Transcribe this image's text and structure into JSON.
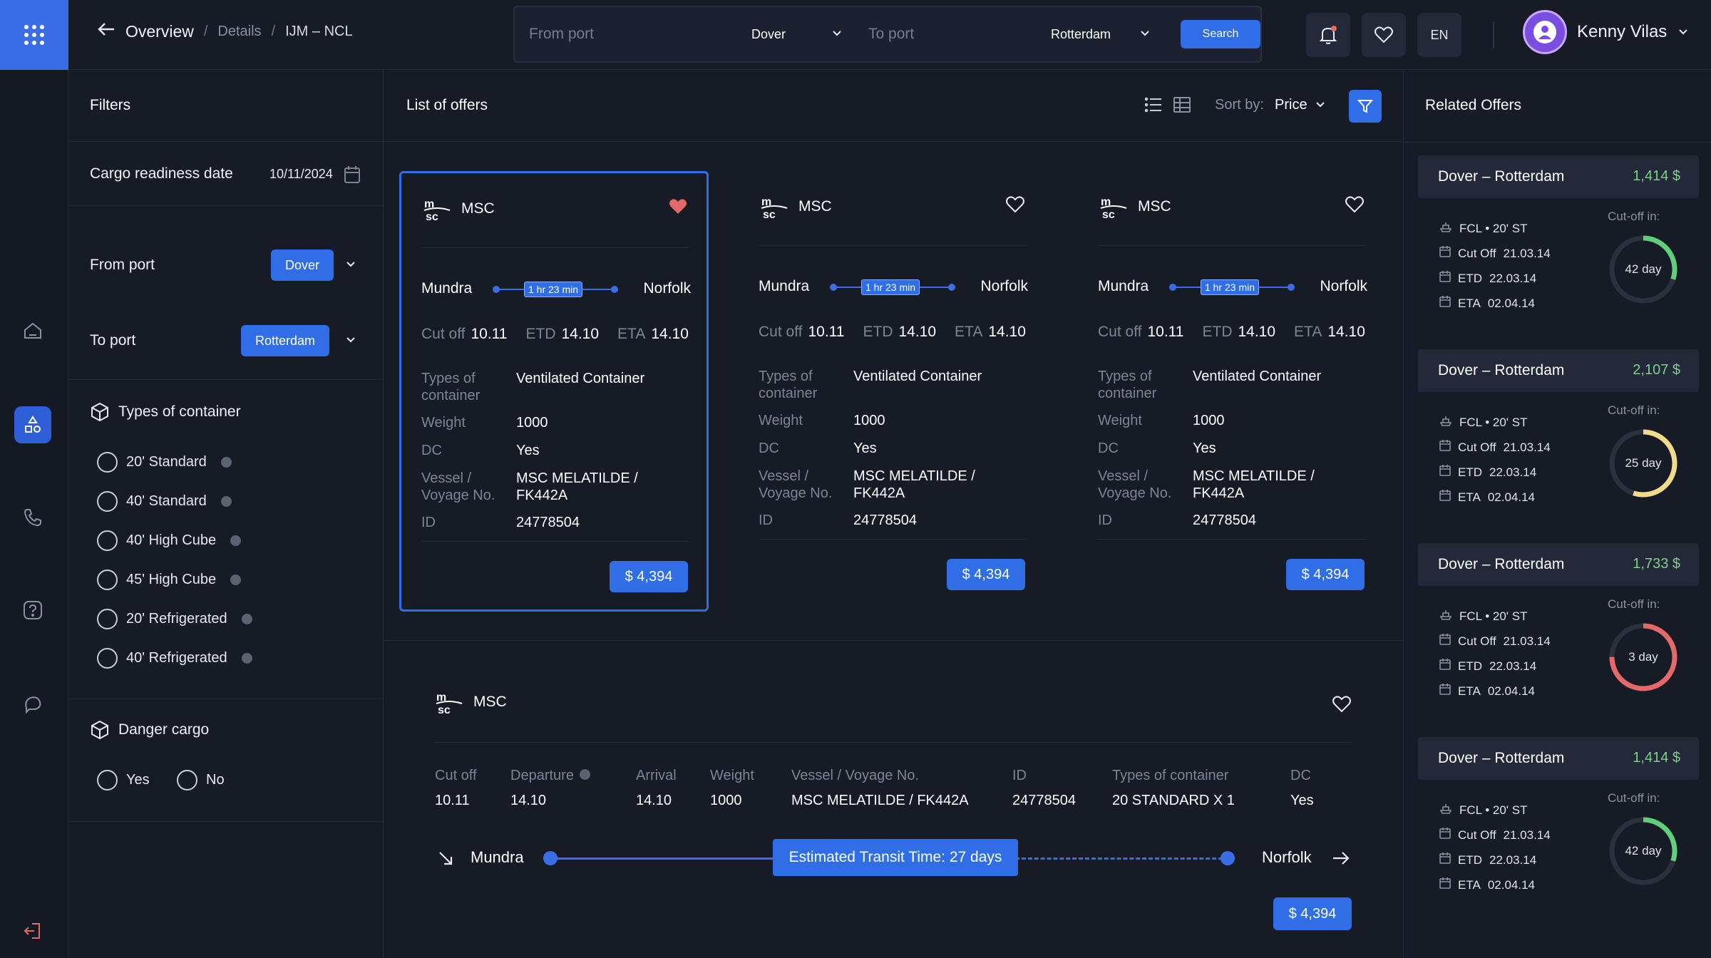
{
  "header": {
    "breadcrumb": {
      "title": "Overview",
      "sep1": "/",
      "details": "Details",
      "sep2": "/",
      "route": "IJM – NCL"
    },
    "search": {
      "from_placeholder": "From port",
      "from_value": "Dover",
      "to_placeholder": "To port",
      "to_value": "Rotterdam",
      "button": "Search"
    },
    "language": "EN",
    "user": {
      "name": "Kenny Vilas"
    }
  },
  "filters": {
    "title": "Filters",
    "cargo_label": "Cargo readiness date",
    "cargo_date": "10/11/2024",
    "from_port_label": "From port",
    "from_port_value": "Dover",
    "to_port_label": "To port",
    "to_port_value": "Rotterdam",
    "container_title": "Types of container",
    "containers": [
      "20' Standard",
      "40' Standard",
      "40' High Cube",
      "45' High Cube",
      "20' Refrigerated",
      "40' Refrigerated"
    ],
    "danger_title": "Danger cargo",
    "danger_yes": "Yes",
    "danger_no": "No"
  },
  "list": {
    "title": "List of offers",
    "sort_label": "Sort by:",
    "sort_value": "Price"
  },
  "offers": [
    {
      "carrier": "MSC",
      "from": "Mundra",
      "to": "Norfolk",
      "duration": "1 hr 23 min",
      "cutoff_label": "Cut off",
      "cutoff": "10.11",
      "etd_label": "ETD",
      "etd": "14.10",
      "eta_label": "ETA",
      "eta": "14.10",
      "types_label": "Types of container",
      "types": "Ventilated Container",
      "weight_label": "Weight",
      "weight": "1000",
      "dc_label": "DC",
      "dc": "Yes",
      "vessel_label": "Vessel / Voyage No.",
      "vessel": "MSC MELATILDE / FK442A",
      "id_label": "ID",
      "id": "24778504",
      "price": "$ 4,394",
      "favorite": true
    },
    {
      "carrier": "MSC",
      "from": "Mundra",
      "to": "Norfolk",
      "duration": "1 hr 23 min",
      "cutoff_label": "Cut off",
      "cutoff": "10.11",
      "etd_label": "ETD",
      "etd": "14.10",
      "eta_label": "ETA",
      "eta": "14.10",
      "types_label": "Types of container",
      "types": "Ventilated Container",
      "weight_label": "Weight",
      "weight": "1000",
      "dc_label": "DC",
      "dc": "Yes",
      "vessel_label": "Vessel / Voyage No.",
      "vessel": "MSC MELATILDE / FK442A",
      "id_label": "ID",
      "id": "24778504",
      "price": "$ 4,394",
      "favorite": false
    },
    {
      "carrier": "MSC",
      "from": "Mundra",
      "to": "Norfolk",
      "duration": "1 hr 23 min",
      "cutoff_label": "Cut off",
      "cutoff": "10.11",
      "etd_label": "ETD",
      "etd": "14.10",
      "eta_label": "ETA",
      "eta": "14.10",
      "types_label": "Types of container",
      "types": "Ventilated Container",
      "weight_label": "Weight",
      "weight": "1000",
      "dc_label": "DC",
      "dc": "Yes",
      "vessel_label": "Vessel / Voyage No.",
      "vessel": "MSC MELATILDE / FK442A",
      "id_label": "ID",
      "id": "24778504",
      "price": "$ 4,394",
      "favorite": false
    }
  ],
  "wide_offer": {
    "carrier": "MSC",
    "cols": [
      {
        "label": "Cut off",
        "value": "10.11"
      },
      {
        "label": "Departure",
        "value": "14.10"
      },
      {
        "label": "Arrival",
        "value": "14.10"
      },
      {
        "label": "Weight",
        "value": "1000"
      },
      {
        "label": "Vessel / Voyage No.",
        "value": "MSC MELATILDE / FK442A"
      },
      {
        "label": "ID",
        "value": "24778504"
      },
      {
        "label": "Types of container",
        "value": "20 STANDARD X 1"
      },
      {
        "label": "DC",
        "value": "Yes"
      }
    ],
    "from": "Mundra",
    "to": "Norfolk",
    "transit": "Estimated Transit Time: 27 days",
    "price": "$ 4,394"
  },
  "related": {
    "title": "Related Offers",
    "items": [
      {
        "route": "Dover  –  Rotterdam",
        "price": "1,414  $",
        "type": "FCL • 20' ST",
        "cutoff_label": "Cut Off",
        "cutoff": "21.03.14",
        "etd_label": "ETD",
        "etd": "22.03.14",
        "eta_label": "ETA",
        "eta": "02.04.14",
        "cut_in": "Cut-off in:",
        "days": "42 day",
        "level": 0.3,
        "color": "#5fcf7a"
      },
      {
        "route": "Dover  –  Rotterdam",
        "price": "2,107  $",
        "type": "FCL • 20' ST",
        "cutoff_label": "Cut Off",
        "cutoff": "21.03.14",
        "etd_label": "ETD",
        "etd": "22.03.14",
        "eta_label": "ETA",
        "eta": "02.04.14",
        "cut_in": "Cut-off in:",
        "days": "25 day",
        "level": 0.55,
        "color": "#f2dc8c"
      },
      {
        "route": "Dover  –  Rotterdam",
        "price": "1,733  $",
        "type": "FCL • 20' ST",
        "cutoff_label": "Cut Off",
        "cutoff": "21.03.14",
        "etd_label": "ETD",
        "etd": "22.03.14",
        "eta_label": "ETA",
        "eta": "02.04.14",
        "cut_in": "Cut-off in:",
        "days": "3 day",
        "level": 0.75,
        "color": "#e46a6a"
      },
      {
        "route": "Dover  –  Rotterdam",
        "price": "1,414  $",
        "type": "FCL • 20' ST",
        "cutoff_label": "Cut Off",
        "cutoff": "21.03.14",
        "etd_label": "ETD",
        "etd": "22.03.14",
        "eta_label": "ETA",
        "eta": "02.04.14",
        "cut_in": "Cut-off in:",
        "days": "42 day",
        "level": 0.3,
        "color": "#5fcf7a"
      }
    ]
  },
  "colors": {
    "accent": "#2f6ee6",
    "background": "#161b26",
    "favorite": "#e46a6a",
    "price_green": "#7fd08a"
  }
}
